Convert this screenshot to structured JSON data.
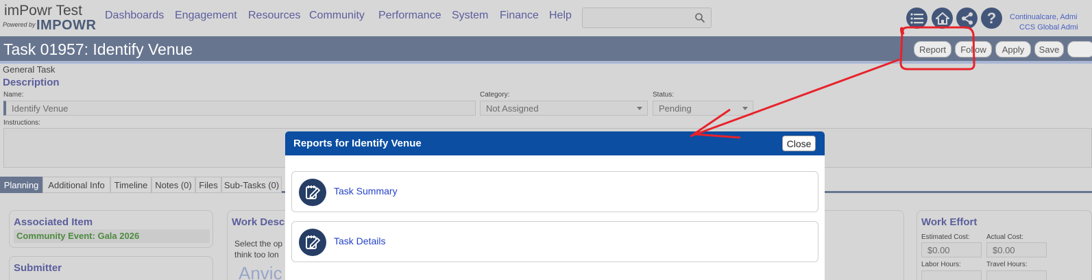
{
  "brand": {
    "title": "imPowr Test",
    "powered_by": "Powered by",
    "logo_text": "IMPOWR"
  },
  "nav": [
    "Dashboards",
    "Engagement",
    "Resources",
    "Community",
    "Performance",
    "System",
    "Finance",
    "Help"
  ],
  "search": {
    "placeholder": ""
  },
  "header_icons": [
    "list-icon",
    "home-icon",
    "share-icon",
    "help-icon"
  ],
  "user": {
    "line1": "Continualcare, Admi",
    "line2": "CCS Global Admi"
  },
  "page": {
    "title": "Task 01957: Identify Venue",
    "type_label": "General Task",
    "buttons": [
      "Report",
      "Follow",
      "Apply",
      "Save"
    ]
  },
  "description": {
    "heading": "Description",
    "name_label": "Name:",
    "name_value": "Identify Venue",
    "category_label": "Category:",
    "category_value": "Not Assigned",
    "status_label": "Status:",
    "status_value": "Pending",
    "instructions_label": "Instructions:"
  },
  "tabs": [
    "Planning",
    "Additional Info",
    "Timeline",
    "Notes (0)",
    "Files",
    "Sub-Tasks (0)"
  ],
  "associated_item": {
    "heading": "Associated Item",
    "value": "Community Event: Gala 2026"
  },
  "submitter": {
    "heading": "Submitter"
  },
  "work_description": {
    "heading": "Work Descr",
    "line1": "Select the op",
    "line2": "think too lon",
    "partial": "Anvic"
  },
  "work_effort": {
    "heading": "Work Effort",
    "estimated_cost_label": "Estimated Cost:",
    "estimated_cost_value": "$0.00",
    "actual_cost_label": "Actual Cost:",
    "actual_cost_value": "$0.00",
    "labor_hours_label": "Labor Hours:",
    "travel_hours_label": "Travel Hours:"
  },
  "modal": {
    "title": "Reports for Identify Venue",
    "close_label": "Close",
    "items": [
      "Task Summary",
      "Task Details"
    ]
  },
  "colors": {
    "title_bar": "#67758f",
    "modal_header": "#0b4ea2",
    "annotation": "#e8222a",
    "link": "#2441c7"
  }
}
